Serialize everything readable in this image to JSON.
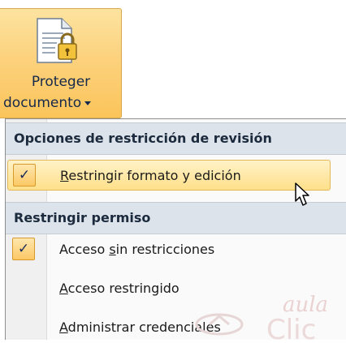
{
  "ribbon_button": {
    "line1": "Proteger",
    "line2": "documento"
  },
  "menu": {
    "section1_header": "Opciones de restricción de revisión",
    "item_restrict_format": {
      "hotkey": "R",
      "rest": "estringir formato y edición",
      "check": "✓"
    },
    "section2_header": "Restringir permiso",
    "item_unrestricted": {
      "pre": "Acceso ",
      "hotkey": "s",
      "rest": "in restricciones",
      "check": "✓"
    },
    "item_restricted": {
      "hotkey": "A",
      "rest": "cceso restringido"
    },
    "item_credentials": {
      "hotkey": "A",
      "rest": "dministrar credenciales"
    }
  },
  "watermark_text": "aula Clic"
}
